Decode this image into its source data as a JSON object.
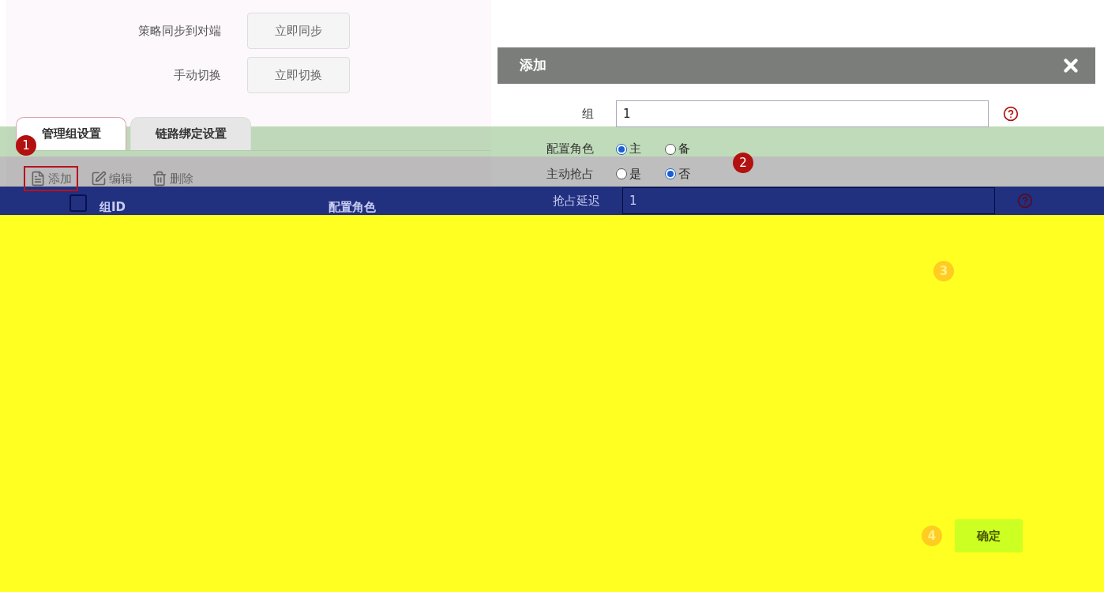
{
  "settings": [
    {
      "label": "策略同步到对端",
      "button": "立即同步"
    },
    {
      "label": "手动切换",
      "button": "立即切换"
    }
  ],
  "tabs": [
    {
      "label": "管理组设置",
      "selected": true
    },
    {
      "label": "链路绑定设置",
      "selected": false
    }
  ],
  "toolbar": [
    {
      "kind": "add",
      "label": "添加",
      "highlighted": true
    },
    {
      "kind": "edit",
      "label": "编辑",
      "highlighted": false
    },
    {
      "kind": "delete",
      "label": "删除",
      "highlighted": false
    }
  ],
  "table": {
    "select_all": {
      "checked": false
    },
    "columns": [
      "组ID",
      "配置角色"
    ]
  },
  "steps": [
    "1",
    "2",
    "3",
    "4"
  ],
  "dialog": {
    "title": "添加",
    "fields": [
      {
        "kind": "text",
        "label": "组",
        "value": "1"
      },
      {
        "kind": "radio",
        "label": "配置角色",
        "options": [
          {
            "label": "主",
            "selected": true
          },
          {
            "label": "备",
            "selected": false
          }
        ]
      },
      {
        "kind": "radio",
        "label": "主动抢占",
        "options": [
          {
            "label": "是",
            "selected": false
          },
          {
            "label": "否",
            "selected": true
          }
        ]
      },
      {
        "kind": "text",
        "label": "抢占延迟",
        "value": "1"
      }
    ],
    "confirm": "确定"
  }
}
